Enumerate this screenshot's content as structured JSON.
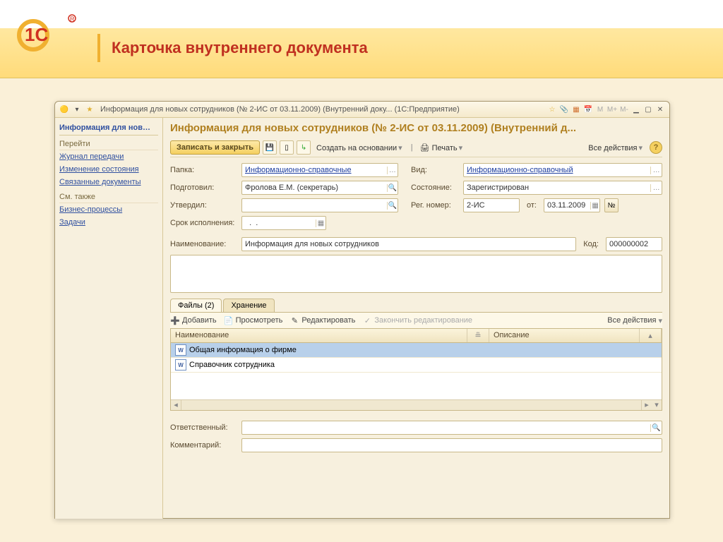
{
  "slide": {
    "title": "Карточка внутреннего документа"
  },
  "window": {
    "title": "Информация для новых сотрудников (№ 2-ИС от 03.11.2009) (Внутренний доку...  (1С:Предприятие)",
    "document_title": "Информация для новых сотрудников (№ 2-ИС от 03.11.2009) (Внутренний д..."
  },
  "sidebar": {
    "title": "Информация для нов…",
    "section_goto": "Перейти",
    "links_goto": [
      "Журнал передачи",
      "Изменение состояния",
      "Связанные документы"
    ],
    "section_see": "См. также",
    "links_see": [
      "Бизнес-процессы",
      "Задачи"
    ]
  },
  "toolbar": {
    "save_close": "Записать и закрыть",
    "create_based": "Создать на основании",
    "print": "Печать",
    "all_actions": "Все действия"
  },
  "form": {
    "folder_label": "Папка:",
    "folder_value": "Информационно-справочные",
    "type_label": "Вид:",
    "type_value": "Информационно-справочный",
    "prepared_label": "Подготовил:",
    "prepared_value": "Фролова Е.М. (секретарь)",
    "state_label": "Состояние:",
    "state_value": "Зарегистрирован",
    "approved_label": "Утвердил:",
    "approved_value": "",
    "regnum_label": "Рег. номер:",
    "regnum_value": "2-ИС",
    "from_label": "от:",
    "date_value": "03.11.2009",
    "deadline_label": "Срок исполнения:",
    "deadline_value": "  .  .",
    "name_label": "Наименование:",
    "name_value": "Информация для новых сотрудников",
    "code_label": "Код:",
    "code_value": "000000002",
    "responsible_label": "Ответственный:",
    "responsible_value": "",
    "comment_label": "Комментарий:",
    "comment_value": "",
    "num_btn": "№"
  },
  "tabs": {
    "files": "Файлы (2)",
    "storage": "Хранение"
  },
  "file_toolbar": {
    "add": "Добавить",
    "view": "Просмотреть",
    "edit": "Редактировать",
    "finish": "Закончить редактирование",
    "all_actions": "Все действия"
  },
  "grid": {
    "col_name": "Наименование",
    "col_desc": "Описание",
    "rows": [
      {
        "name": "Общая информация о фирме",
        "desc": ""
      },
      {
        "name": "Справочник сотрудника",
        "desc": ""
      }
    ]
  }
}
